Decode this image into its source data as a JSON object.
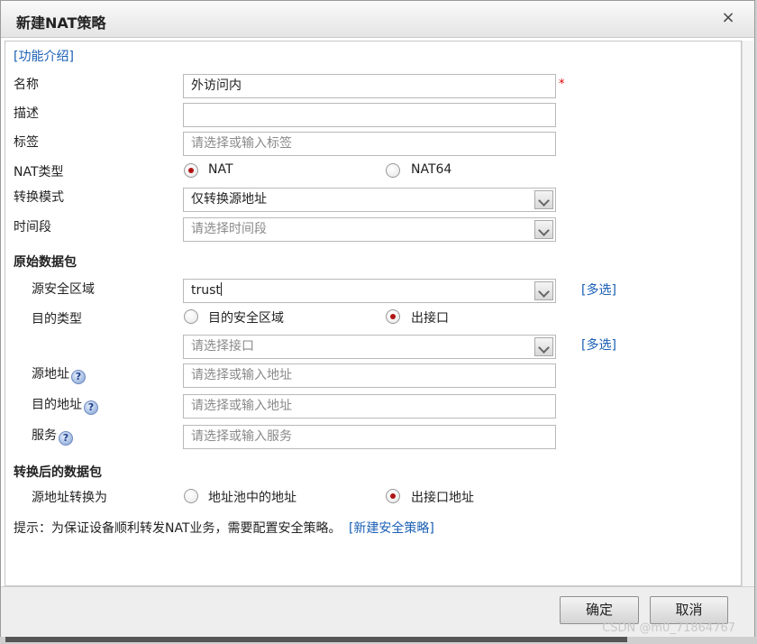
{
  "dialog": {
    "title": "新建NAT策略",
    "close_glyph": "×",
    "intro_link": "[功能介绍]"
  },
  "fields": {
    "name": {
      "label": "名称",
      "value": "外访问内",
      "required_mark": "*"
    },
    "description": {
      "label": "描述",
      "value": ""
    },
    "tags": {
      "label": "标签",
      "placeholder": "请选择或输入标签"
    },
    "nat_type": {
      "label": "NAT类型",
      "options": [
        "NAT",
        "NAT64"
      ],
      "selected": "NAT"
    },
    "convert_mode": {
      "label": "转换模式",
      "value": "仅转换源地址"
    },
    "time_range": {
      "label": "时间段",
      "placeholder": "请选择时间段"
    }
  },
  "original_packet": {
    "section_title": "原始数据包",
    "source_zone": {
      "label": "源安全区域",
      "value": "trust",
      "multi_link": "[多选]"
    },
    "dest_type": {
      "label": "目的类型",
      "options": [
        "目的安全区域",
        "出接口"
      ],
      "selected": "出接口"
    },
    "interface": {
      "placeholder": "请选择接口",
      "multi_link": "[多选]"
    },
    "source_address": {
      "label": "源地址",
      "placeholder": "请选择或输入地址"
    },
    "dest_address": {
      "label": "目的地址",
      "placeholder": "请选择或输入地址"
    },
    "service": {
      "label": "服务",
      "placeholder": "请选择或输入服务"
    },
    "help_glyph": "?"
  },
  "translated_packet": {
    "section_title": "转换后的数据包",
    "source_translate": {
      "label": "源地址转换为",
      "options": [
        "地址池中的地址",
        "出接口地址"
      ],
      "selected": "出接口地址"
    }
  },
  "hint": {
    "text": "提示：为保证设备顺利转发NAT业务，需要配置安全策略。",
    "link": "[新建安全策略]"
  },
  "buttons": {
    "ok": "确定",
    "cancel": "取消"
  },
  "watermark": "CSDN @m0_71864767",
  "colors": {
    "link": "#1a5fb4",
    "radio_dot": "#b01313",
    "required": "#dd0000"
  }
}
